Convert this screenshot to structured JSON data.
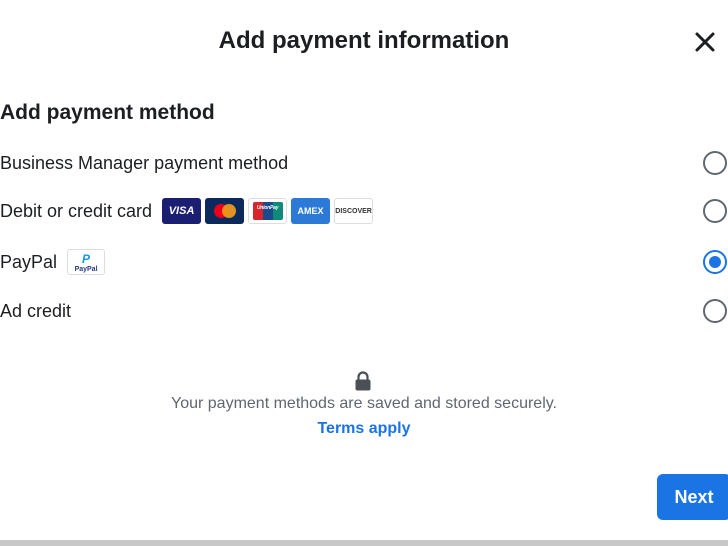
{
  "dialog": {
    "title": "Add payment information",
    "close_icon": "close-icon"
  },
  "section_title": "Add payment method",
  "options": [
    {
      "label": "Business Manager payment method",
      "selected": false
    },
    {
      "label": "Debit or credit card",
      "selected": false,
      "cards": [
        "VISA",
        "Mastercard",
        "UnionPay",
        "AMEX",
        "DISCOVER"
      ]
    },
    {
      "label": "PayPal",
      "selected": true,
      "logo": "PayPal"
    },
    {
      "label": "Ad credit",
      "selected": false
    }
  ],
  "security": {
    "icon": "lock-icon",
    "text": "Your payment methods are saved and stored securely.",
    "terms_label": "Terms apply"
  },
  "next_label": "Next",
  "colors": {
    "accent": "#1b74e4"
  }
}
